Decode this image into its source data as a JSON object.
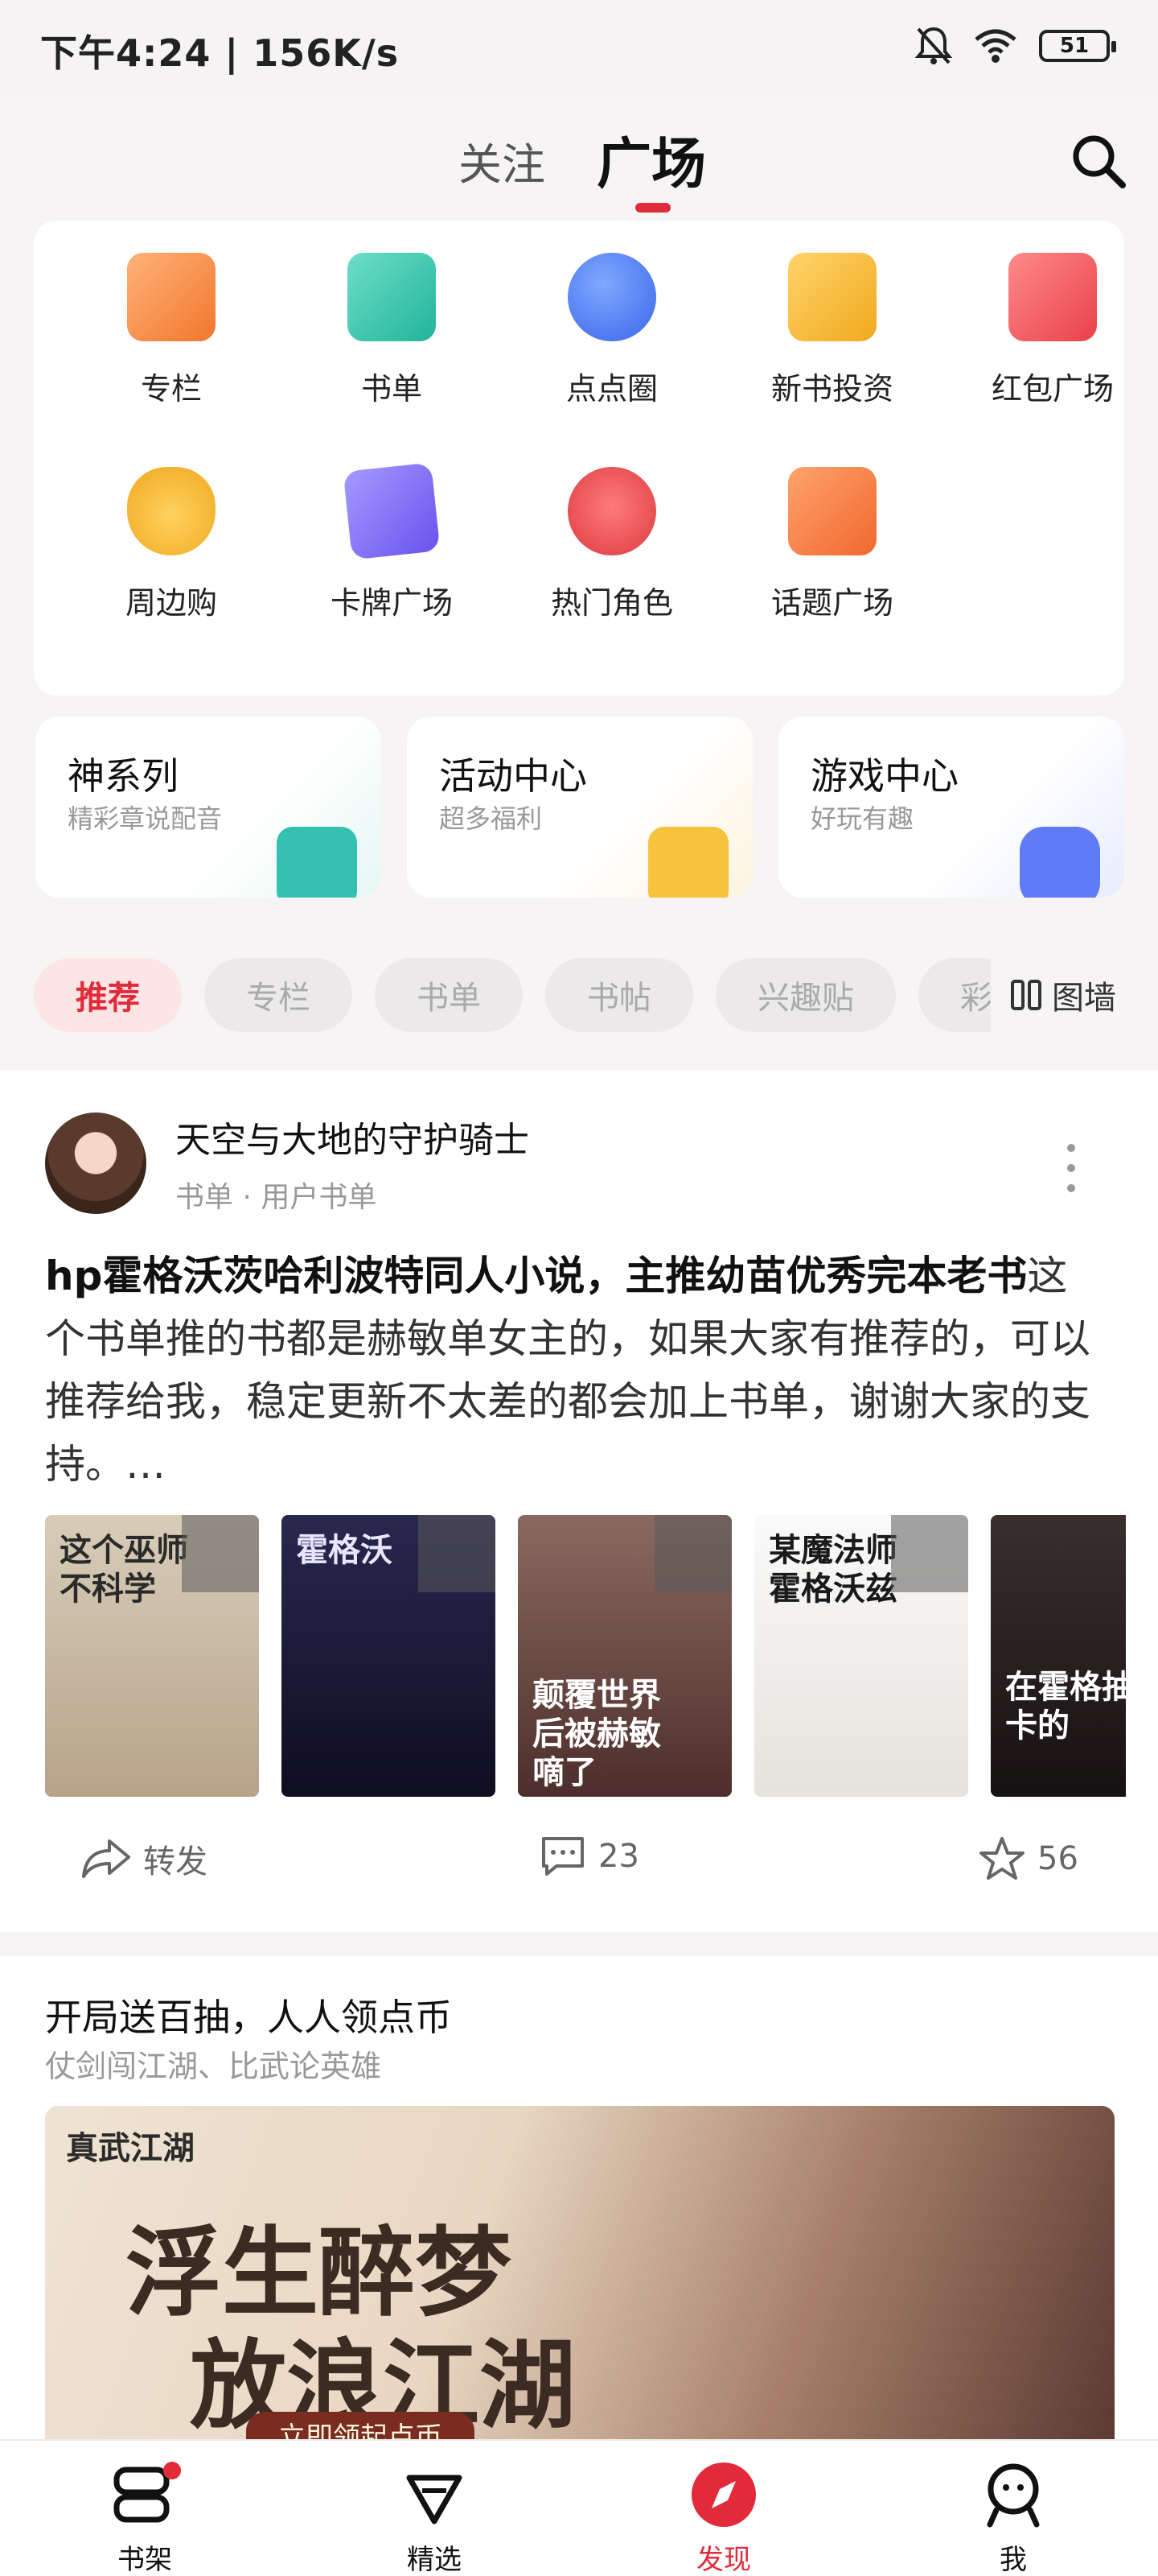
{
  "status": {
    "time": "下午4:24 | 156K/s",
    "battery": "51"
  },
  "header": {
    "tab_follow": "关注",
    "tab_square": "广场"
  },
  "grid": [
    {
      "label": "专栏",
      "icon": "column-icon",
      "color": "#f58a4a"
    },
    {
      "label": "书单",
      "icon": "booklist-icon",
      "color": "#3cc3a9"
    },
    {
      "label": "点点圈",
      "icon": "circle-icon",
      "color": "#4a7af5"
    },
    {
      "label": "新书投资",
      "icon": "invest-icon",
      "color": "#f6b93b"
    },
    {
      "label": "红包广场",
      "icon": "redpacket-icon",
      "color": "#f05a5a"
    },
    {
      "label": "周边购",
      "icon": "fox-icon",
      "color": "#f7b733"
    },
    {
      "label": "卡牌广场",
      "icon": "card-icon",
      "color": "#7b6cf6"
    },
    {
      "label": "热门角色",
      "icon": "character-icon",
      "color": "#ef5350"
    },
    {
      "label": "话题广场",
      "icon": "topic-icon",
      "color": "#f5864a"
    }
  ],
  "features": [
    {
      "title": "神系列",
      "subtitle": "精彩章说配音",
      "icon": "god-series-icon",
      "color": "#34c1b1"
    },
    {
      "title": "活动中心",
      "subtitle": "超多福利",
      "icon": "gift-icon",
      "color": "#f7c23c"
    },
    {
      "title": "游戏中心",
      "subtitle": "好玩有趣",
      "icon": "gamepad-icon",
      "color": "#5f7cf6"
    }
  ],
  "chips": [
    "推荐",
    "专栏",
    "书单",
    "书帖",
    "兴趣贴",
    "彩蛋章"
  ],
  "picwall_label": "图墙",
  "post": {
    "author": "天空与大地的守护骑士",
    "meta": "书单 · 用户书单",
    "title": "hp霍格沃茨哈利波特同人小说，主推幼苗优秀完本老书",
    "body": "这个书单推的书都是赫敏单女主的，如果大家有推荐的，可以推荐给我，稳定更新不太差的都会加上书单，谢谢大家的支持。…",
    "books": [
      {
        "title": "这个巫师不科学",
        "bg": "#c9b9a3"
      },
      {
        "title": "霍格沃",
        "bg": "#1e1b3a"
      },
      {
        "title": "颠覆世界后被赫敏嘀了",
        "bg": "#6a4a46"
      },
      {
        "title": "某魔法师霍格沃兹",
        "bg": "#f4f2ee"
      },
      {
        "title": "在霍格抽卡的",
        "bg": "#2b2324"
      }
    ],
    "share_label": "转发",
    "comments": "23",
    "stars": "56"
  },
  "promo": {
    "title": "开局送百抽，人人领点币",
    "subtitle": "仗剑闯江湖、比武论英雄",
    "logo": "真武江湖",
    "line1": "浮生醉梦",
    "line2": "放浪江湖",
    "cta": "立即领起点币"
  },
  "nav": [
    {
      "label": "书架",
      "icon": "bookshelf-icon"
    },
    {
      "label": "精选",
      "icon": "diamond-icon"
    },
    {
      "label": "发现",
      "icon": "compass-icon"
    },
    {
      "label": "我",
      "icon": "profile-icon"
    }
  ],
  "colors": {
    "accent": "#e12b3a"
  }
}
